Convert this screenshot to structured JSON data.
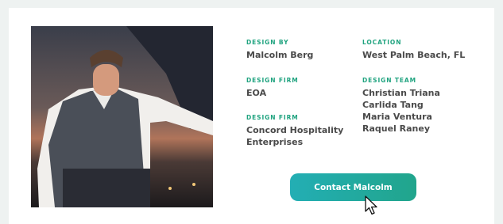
{
  "profile": {
    "photo_icon": "designer-portrait-photo",
    "fields": {
      "design_by": {
        "label": "DESIGN BY",
        "value": "Malcolm Berg"
      },
      "location": {
        "label": "LOCATION",
        "value": "West Palm Beach, FL"
      },
      "design_firm_1": {
        "label": "DESIGN FIRM",
        "value": "EOA"
      },
      "design_firm_2": {
        "label": "DESIGN FIRM",
        "lines": [
          "Concord Hospitality",
          "Enterprises"
        ]
      },
      "design_team": {
        "label": "DESIGN TEAM",
        "members": [
          "Christian Triana",
          "Carlida Tang",
          "Maria Ventura",
          "Raquel Raney"
        ]
      }
    },
    "contact_button": {
      "label": "Contact Malcolm"
    }
  },
  "colors": {
    "accent_label": "#1fa37f",
    "button_start": "#23aeb4",
    "button_end": "#21a58c",
    "text": "#4a4a4a",
    "page_bg": "#eef2f1"
  },
  "cursor_icon": "pointer-arrow-icon"
}
